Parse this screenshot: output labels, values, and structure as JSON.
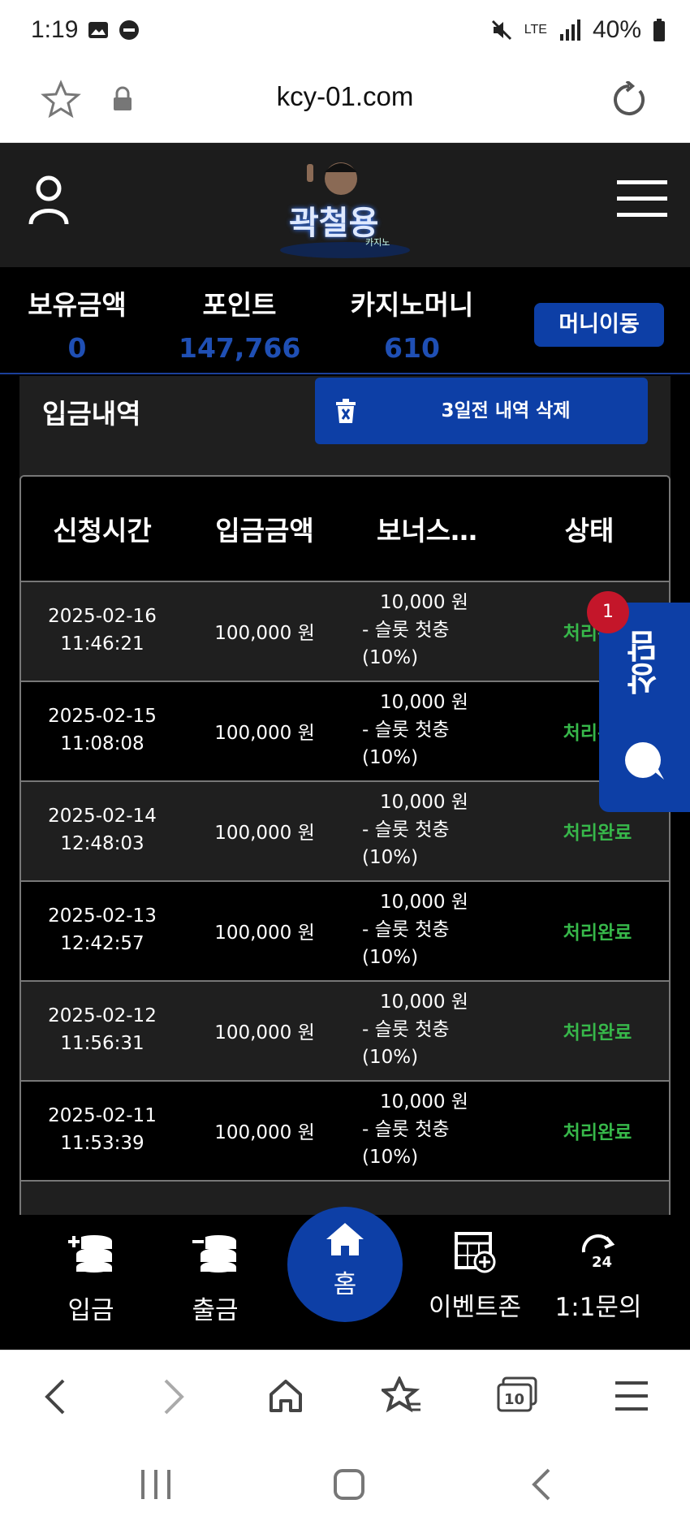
{
  "status_bar": {
    "time": "1:19",
    "battery": "40%",
    "network": "LTE"
  },
  "browser": {
    "url": "kcy-01.com"
  },
  "header": {
    "logo_text": "곽철용",
    "logo_sub": "카지노"
  },
  "balance": {
    "holding_label": "보유금액",
    "holding_value": "0",
    "point_label": "포인트",
    "point_value": "147,766",
    "casino_label": "카지노머니",
    "casino_value": "610",
    "move_button": "머니이동"
  },
  "deposit": {
    "title": "입금내역",
    "delete_button": "3일전 내역 삭제",
    "columns": [
      "신청시간",
      "입금금액",
      "보너스…",
      "상태"
    ],
    "rows": [
      {
        "date": "2025-02-16",
        "time": "11:46:21",
        "amount": "100,000 원",
        "bonus_amount": "10,000 원",
        "bonus_type": "- 슬롯 첫충",
        "bonus_rate": "(10%)",
        "status": "처리완료"
      },
      {
        "date": "2025-02-15",
        "time": "11:08:08",
        "amount": "100,000 원",
        "bonus_amount": "10,000 원",
        "bonus_type": "- 슬롯 첫충",
        "bonus_rate": "(10%)",
        "status": "처리완료"
      },
      {
        "date": "2025-02-14",
        "time": "12:48:03",
        "amount": "100,000 원",
        "bonus_amount": "10,000 원",
        "bonus_type": "- 슬롯 첫충",
        "bonus_rate": "(10%)",
        "status": "처리완료"
      },
      {
        "date": "2025-02-13",
        "time": "12:42:57",
        "amount": "100,000 원",
        "bonus_amount": "10,000 원",
        "bonus_type": "- 슬롯 첫충",
        "bonus_rate": "(10%)",
        "status": "처리완료"
      },
      {
        "date": "2025-02-12",
        "time": "11:56:31",
        "amount": "100,000 원",
        "bonus_amount": "10,000 원",
        "bonus_type": "- 슬롯 첫충",
        "bonus_rate": "(10%)",
        "status": "처리완료"
      },
      {
        "date": "2025-02-11",
        "time": "11:53:39",
        "amount": "100,000 원",
        "bonus_amount": "10,000 원",
        "bonus_type": "- 슬롯 첫충",
        "bonus_rate": "(10%)",
        "status": "처리완료"
      }
    ]
  },
  "chat": {
    "label": "상담",
    "badge": "1"
  },
  "bottom_nav": {
    "deposit": "입금",
    "withdraw": "출금",
    "home": "홈",
    "event": "이벤트존",
    "inquiry": "1:1문의"
  },
  "colors": {
    "accent": "#0d3fa6",
    "status_done": "#37b84a",
    "value_blue": "#1f4fb4"
  }
}
